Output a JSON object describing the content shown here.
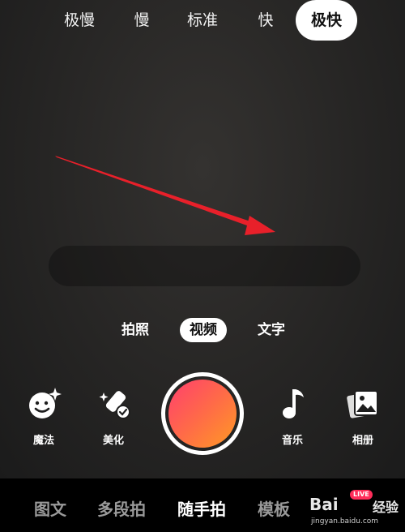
{
  "speed": {
    "items": [
      "极慢",
      "慢",
      "标准",
      "快",
      "极快"
    ],
    "selected": "极快"
  },
  "modes": {
    "items": [
      "拍照",
      "视频",
      "文字"
    ],
    "selected": "视频"
  },
  "tools": {
    "magic": "魔法",
    "beauty": "美化",
    "music": "音乐",
    "album": "相册"
  },
  "nav": {
    "items": [
      "图文",
      "多段拍",
      "随手拍",
      "模板"
    ],
    "selected": "随手拍"
  },
  "watermark": {
    "brand": "Bai",
    "brand2": "经验",
    "live": "LIVE",
    "url": "jingyan.baidu.com"
  },
  "colors": {
    "record_start": "#ff3f6e",
    "record_end": "#ff9a24",
    "arrow": "#e8202a"
  }
}
